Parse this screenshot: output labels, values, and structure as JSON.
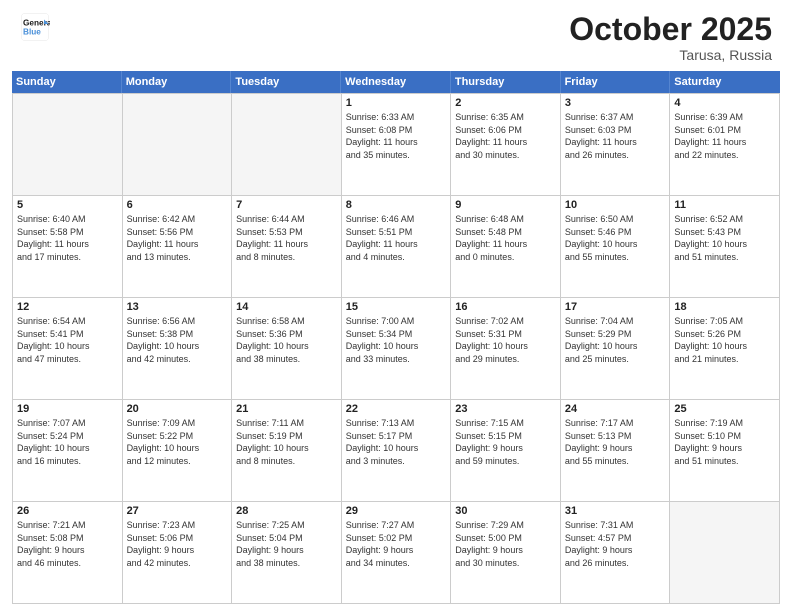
{
  "header": {
    "logo_line1": "General",
    "logo_line2": "Blue",
    "month": "October 2025",
    "location": "Tarusa, Russia"
  },
  "weekdays": [
    "Sunday",
    "Monday",
    "Tuesday",
    "Wednesday",
    "Thursday",
    "Friday",
    "Saturday"
  ],
  "weeks": [
    [
      {
        "day": "",
        "info": ""
      },
      {
        "day": "",
        "info": ""
      },
      {
        "day": "",
        "info": ""
      },
      {
        "day": "1",
        "info": "Sunrise: 6:33 AM\nSunset: 6:08 PM\nDaylight: 11 hours\nand 35 minutes."
      },
      {
        "day": "2",
        "info": "Sunrise: 6:35 AM\nSunset: 6:06 PM\nDaylight: 11 hours\nand 30 minutes."
      },
      {
        "day": "3",
        "info": "Sunrise: 6:37 AM\nSunset: 6:03 PM\nDaylight: 11 hours\nand 26 minutes."
      },
      {
        "day": "4",
        "info": "Sunrise: 6:39 AM\nSunset: 6:01 PM\nDaylight: 11 hours\nand 22 minutes."
      }
    ],
    [
      {
        "day": "5",
        "info": "Sunrise: 6:40 AM\nSunset: 5:58 PM\nDaylight: 11 hours\nand 17 minutes."
      },
      {
        "day": "6",
        "info": "Sunrise: 6:42 AM\nSunset: 5:56 PM\nDaylight: 11 hours\nand 13 minutes."
      },
      {
        "day": "7",
        "info": "Sunrise: 6:44 AM\nSunset: 5:53 PM\nDaylight: 11 hours\nand 8 minutes."
      },
      {
        "day": "8",
        "info": "Sunrise: 6:46 AM\nSunset: 5:51 PM\nDaylight: 11 hours\nand 4 minutes."
      },
      {
        "day": "9",
        "info": "Sunrise: 6:48 AM\nSunset: 5:48 PM\nDaylight: 11 hours\nand 0 minutes."
      },
      {
        "day": "10",
        "info": "Sunrise: 6:50 AM\nSunset: 5:46 PM\nDaylight: 10 hours\nand 55 minutes."
      },
      {
        "day": "11",
        "info": "Sunrise: 6:52 AM\nSunset: 5:43 PM\nDaylight: 10 hours\nand 51 minutes."
      }
    ],
    [
      {
        "day": "12",
        "info": "Sunrise: 6:54 AM\nSunset: 5:41 PM\nDaylight: 10 hours\nand 47 minutes."
      },
      {
        "day": "13",
        "info": "Sunrise: 6:56 AM\nSunset: 5:38 PM\nDaylight: 10 hours\nand 42 minutes."
      },
      {
        "day": "14",
        "info": "Sunrise: 6:58 AM\nSunset: 5:36 PM\nDaylight: 10 hours\nand 38 minutes."
      },
      {
        "day": "15",
        "info": "Sunrise: 7:00 AM\nSunset: 5:34 PM\nDaylight: 10 hours\nand 33 minutes."
      },
      {
        "day": "16",
        "info": "Sunrise: 7:02 AM\nSunset: 5:31 PM\nDaylight: 10 hours\nand 29 minutes."
      },
      {
        "day": "17",
        "info": "Sunrise: 7:04 AM\nSunset: 5:29 PM\nDaylight: 10 hours\nand 25 minutes."
      },
      {
        "day": "18",
        "info": "Sunrise: 7:05 AM\nSunset: 5:26 PM\nDaylight: 10 hours\nand 21 minutes."
      }
    ],
    [
      {
        "day": "19",
        "info": "Sunrise: 7:07 AM\nSunset: 5:24 PM\nDaylight: 10 hours\nand 16 minutes."
      },
      {
        "day": "20",
        "info": "Sunrise: 7:09 AM\nSunset: 5:22 PM\nDaylight: 10 hours\nand 12 minutes."
      },
      {
        "day": "21",
        "info": "Sunrise: 7:11 AM\nSunset: 5:19 PM\nDaylight: 10 hours\nand 8 minutes."
      },
      {
        "day": "22",
        "info": "Sunrise: 7:13 AM\nSunset: 5:17 PM\nDaylight: 10 hours\nand 3 minutes."
      },
      {
        "day": "23",
        "info": "Sunrise: 7:15 AM\nSunset: 5:15 PM\nDaylight: 9 hours\nand 59 minutes."
      },
      {
        "day": "24",
        "info": "Sunrise: 7:17 AM\nSunset: 5:13 PM\nDaylight: 9 hours\nand 55 minutes."
      },
      {
        "day": "25",
        "info": "Sunrise: 7:19 AM\nSunset: 5:10 PM\nDaylight: 9 hours\nand 51 minutes."
      }
    ],
    [
      {
        "day": "26",
        "info": "Sunrise: 7:21 AM\nSunset: 5:08 PM\nDaylight: 9 hours\nand 46 minutes."
      },
      {
        "day": "27",
        "info": "Sunrise: 7:23 AM\nSunset: 5:06 PM\nDaylight: 9 hours\nand 42 minutes."
      },
      {
        "day": "28",
        "info": "Sunrise: 7:25 AM\nSunset: 5:04 PM\nDaylight: 9 hours\nand 38 minutes."
      },
      {
        "day": "29",
        "info": "Sunrise: 7:27 AM\nSunset: 5:02 PM\nDaylight: 9 hours\nand 34 minutes."
      },
      {
        "day": "30",
        "info": "Sunrise: 7:29 AM\nSunset: 5:00 PM\nDaylight: 9 hours\nand 30 minutes."
      },
      {
        "day": "31",
        "info": "Sunrise: 7:31 AM\nSunset: 4:57 PM\nDaylight: 9 hours\nand 26 minutes."
      },
      {
        "day": "",
        "info": ""
      }
    ]
  ]
}
